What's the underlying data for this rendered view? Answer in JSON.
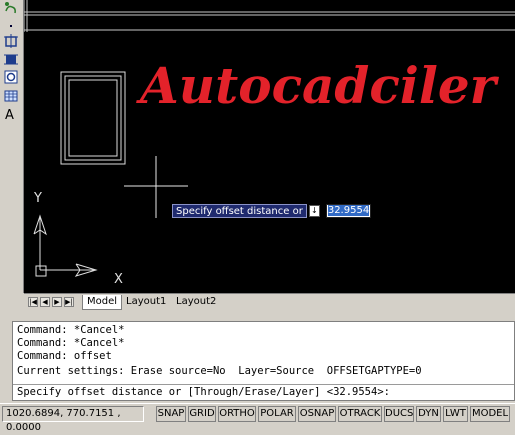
{
  "toolbar": {
    "text_tool_label": "A"
  },
  "watermark": "Autocadciler",
  "dynamic_input": {
    "prompt": "Specify offset distance or",
    "arrow": "↓",
    "value": "32.9554"
  },
  "ucs": {
    "x_label": "X",
    "y_label": "Y"
  },
  "layout_tabs": {
    "nav": [
      "|◀",
      "◀",
      "▶",
      "▶|"
    ],
    "tabs": [
      "Model",
      "Layout1",
      "Layout2"
    ]
  },
  "command_window": {
    "lines": [
      "Command: *Cancel*",
      "Command: *Cancel*",
      "Command: offset",
      "Current settings: Erase source=No  Layer=Source  OFFSETGAPTYPE=0"
    ],
    "prompt": "Specify offset distance or [Through/Erase/Layer] <32.9554>:"
  },
  "status_bar": {
    "coordinates": "1020.6894, 770.7151 , 0.0000",
    "buttons": [
      "SNAP",
      "GRID",
      "ORTHO",
      "POLAR",
      "OSNAP",
      "OTRACK",
      "DUCS",
      "DYN",
      "LWT",
      "MODEL"
    ]
  }
}
